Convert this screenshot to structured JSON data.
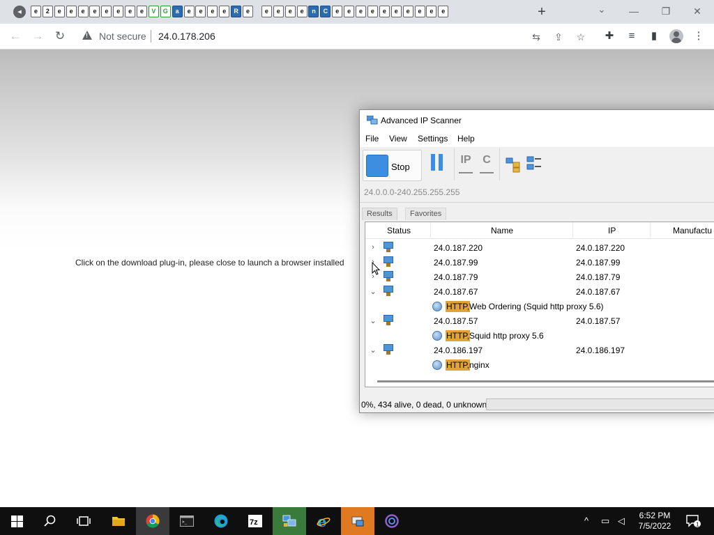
{
  "browser": {
    "tab_favicons": [
      "e",
      "2",
      "e",
      "e",
      "e",
      "e",
      "e",
      "e",
      "e",
      "e",
      "V",
      "G",
      "a",
      "e",
      "e",
      "e",
      "e",
      "R",
      "e",
      "",
      "e",
      "e",
      "e",
      "e",
      "n",
      "C",
      "e",
      "e",
      "e",
      "e",
      "e",
      "e",
      "e",
      "e",
      "e",
      "e"
    ],
    "new_tab_icon": "plus-icon",
    "address": {
      "security_label": "Not secure",
      "url": "24.0.178.206"
    }
  },
  "page": {
    "message": "Click on the download plug-in, please close to launch a browser installed"
  },
  "scanner": {
    "title": "Advanced IP Scanner",
    "menu": [
      "File",
      "View",
      "Settings",
      "Help"
    ],
    "toolbar": {
      "stop_label": "Stop",
      "ip_tool": "IP",
      "c_tool": "C"
    },
    "ip_range": "24.0.0.0-240.255.255.255",
    "tabs": [
      "Results",
      "Favorites"
    ],
    "columns": [
      "Status",
      "Name",
      "IP",
      "Manufactu"
    ],
    "rows": [
      {
        "expanded": false,
        "name": "24.0.187.220",
        "ip": "24.0.187.220"
      },
      {
        "expanded": false,
        "name": "24.0.187.99",
        "ip": "24.0.187.99"
      },
      {
        "expanded": false,
        "name": "24.0.187.79",
        "ip": "24.0.187.79"
      },
      {
        "expanded": true,
        "name": "24.0.187.67",
        "ip": "24.0.187.67",
        "service": {
          "proto": "HTTP,",
          "name": "Web Ordering (Squid http proxy 5.6)"
        }
      },
      {
        "expanded": true,
        "name": "24.0.187.57",
        "ip": "24.0.187.57",
        "service": {
          "proto": "HTTP,",
          "name": "Squid http proxy 5.6"
        }
      },
      {
        "expanded": true,
        "name": "24.0.186.197",
        "ip": "24.0.186.197",
        "service": {
          "proto": "HTTP,",
          "name": "nginx"
        }
      }
    ],
    "status": "0%, 434 alive, 0 dead, 0 unknown"
  },
  "taskbar": {
    "apps": [
      "file-explorer",
      "chrome",
      "terminal",
      "edge",
      "7zip",
      "advanced-ip-scanner",
      "internet-explorer",
      "network-tool",
      "app"
    ],
    "time": "6:52 PM",
    "date": "7/5/2022",
    "notification_count": "1"
  },
  "colors": {
    "accent_blue": "#3d8ee0",
    "http_badge": "#e0a33a",
    "taskbar": "#0f0f10"
  }
}
